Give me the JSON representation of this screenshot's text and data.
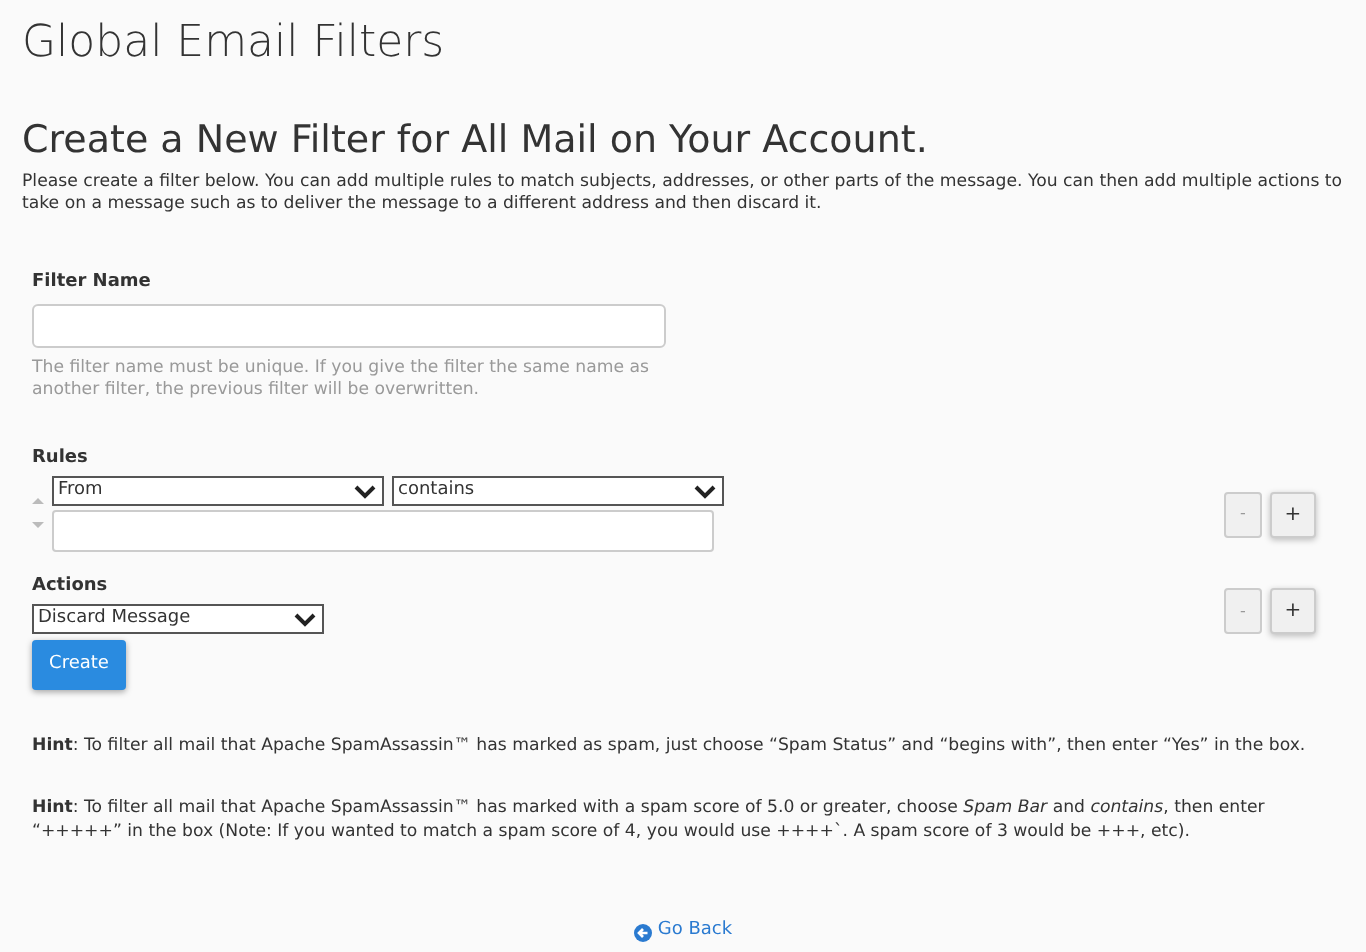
{
  "page_title": "Global Email Filters",
  "heading": "Create a New Filter for All Mail on Your Account.",
  "intro": "Please create a filter below. You can add multiple rules to match subjects, addresses, or other parts of the message. You can then add multiple actions to take on a message such as to deliver the message to a different address and then discard it.",
  "filter_name": {
    "label": "Filter Name",
    "help": "The filter name must be unique. If you give the filter the same name as another filter, the previous filter will be overwritten."
  },
  "rules": {
    "label": "Rules",
    "field": "From",
    "operator": "contains",
    "remove_button": "-",
    "add_button": "+"
  },
  "actions": {
    "label": "Actions",
    "action": "Discard Message",
    "remove_button": "-",
    "add_button": "+"
  },
  "create_button": "Create",
  "hints": [
    "**Hint**: To filter all mail that Apache SpamAssassin™ has marked as spam, just choose “Spam Status” and “begins with”, then enter “Yes” in the box.",
    "**Hint**: To filter all mail that Apache SpamAssassin™ has marked with a spam score of 5.0 or greater, choose *Spam Bar* and *contains*, then enter “+++++” in the box (Note: If you wanted to match a spam score of 4, you would use ++++`. A spam score of 3 would be +++, etc)."
  ],
  "go_back": "Go Back"
}
